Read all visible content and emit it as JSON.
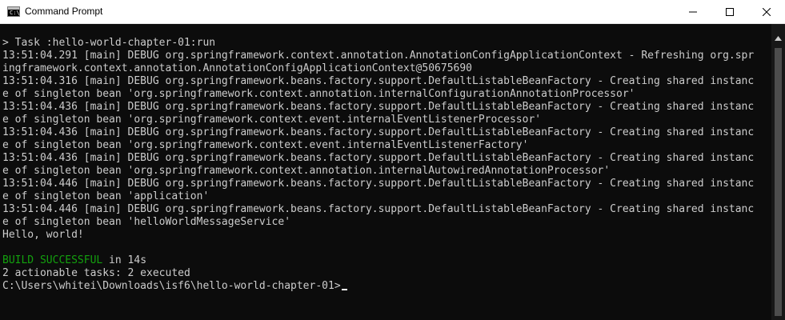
{
  "window": {
    "title": "Command Prompt",
    "icon": "cmd-icon",
    "controls": [
      "minimize-icon",
      "maximize-icon",
      "close-icon"
    ]
  },
  "terminal": {
    "lines": [
      "> Task :hello-world-chapter-01:run",
      "13:51:04.291 [main] DEBUG org.springframework.context.annotation.AnnotationConfigApplicationContext - Refreshing org.spr",
      "ingframework.context.annotation.AnnotationConfigApplicationContext@50675690",
      "13:51:04.316 [main] DEBUG org.springframework.beans.factory.support.DefaultListableBeanFactory - Creating shared instanc",
      "e of singleton bean 'org.springframework.context.annotation.internalConfigurationAnnotationProcessor'",
      "13:51:04.436 [main] DEBUG org.springframework.beans.factory.support.DefaultListableBeanFactory - Creating shared instanc",
      "e of singleton bean 'org.springframework.context.event.internalEventListenerProcessor'",
      "13:51:04.436 [main] DEBUG org.springframework.beans.factory.support.DefaultListableBeanFactory - Creating shared instanc",
      "e of singleton bean 'org.springframework.context.event.internalEventListenerFactory'",
      "13:51:04.436 [main] DEBUG org.springframework.beans.factory.support.DefaultListableBeanFactory - Creating shared instanc",
      "e of singleton bean 'org.springframework.context.annotation.internalAutowiredAnnotationProcessor'",
      "13:51:04.446 [main] DEBUG org.springframework.beans.factory.support.DefaultListableBeanFactory - Creating shared instanc",
      "e of singleton bean 'application'",
      "13:51:04.446 [main] DEBUG org.springframework.beans.factory.support.DefaultListableBeanFactory - Creating shared instanc",
      "e of singleton bean 'helloWorldMessageService'",
      "Hello, world!",
      ""
    ],
    "build_status": "BUILD SUCCESSFUL",
    "build_time": " in 14s",
    "tasks_summary": "2 actionable tasks: 2 executed",
    "prompt": "C:\\Users\\whitei\\Downloads\\isf6\\hello-world-chapter-01>",
    "colors": {
      "background": "#0c0c0c",
      "text": "#cccccc",
      "success": "#13a10e"
    }
  }
}
